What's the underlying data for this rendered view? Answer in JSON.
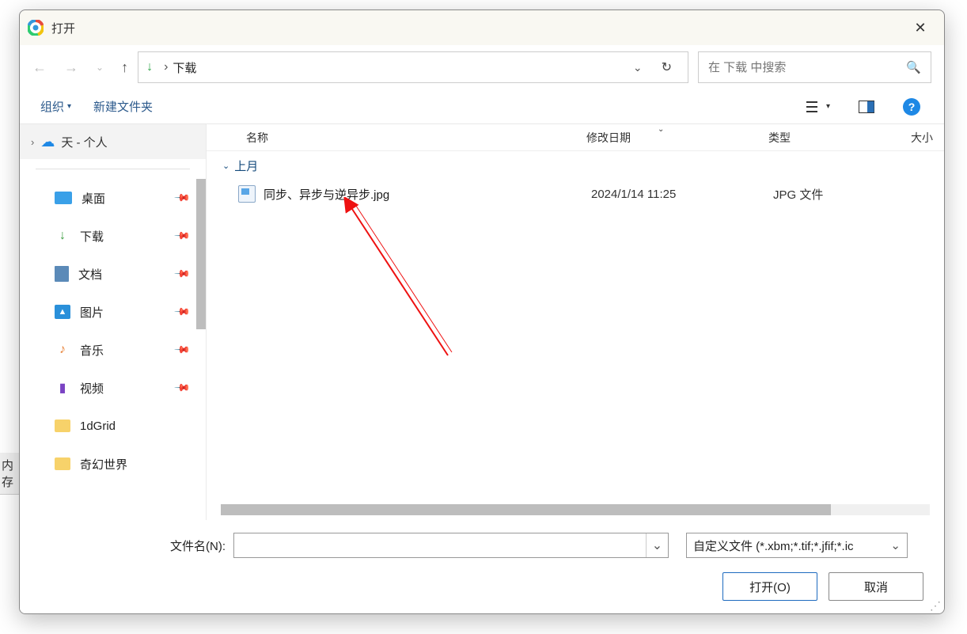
{
  "bg_label": "内存",
  "title": "打开",
  "address": {
    "location": "下载"
  },
  "search": {
    "placeholder": "在 下载 中搜索"
  },
  "toolbar": {
    "organize": "组织",
    "new_folder": "新建文件夹"
  },
  "sidebar": {
    "top": "天 - 个人",
    "items": [
      {
        "label": "桌面",
        "iconClass": "ico-desktop",
        "pinned": true
      },
      {
        "label": "下载",
        "iconClass": "ico-download",
        "glyph": "↓",
        "pinned": true
      },
      {
        "label": "文档",
        "iconClass": "ico-doc",
        "pinned": true
      },
      {
        "label": "图片",
        "iconClass": "ico-pic",
        "glyph": "▲",
        "pinned": true
      },
      {
        "label": "音乐",
        "iconClass": "ico-music",
        "glyph": "♪",
        "pinned": true
      },
      {
        "label": "视频",
        "iconClass": "ico-video",
        "glyph": "▮",
        "pinned": true
      },
      {
        "label": "1dGrid",
        "iconClass": "ico-folder",
        "pinned": false
      },
      {
        "label": "奇幻世界",
        "iconClass": "ico-folder",
        "pinned": false
      }
    ]
  },
  "columns": {
    "name": "名称",
    "date": "修改日期",
    "type": "类型",
    "size": "大小"
  },
  "group": "上月",
  "files": [
    {
      "name": "同步、异步与逆异步.jpg",
      "date": "2024/1/14 11:25",
      "type": "JPG 文件"
    }
  ],
  "footer": {
    "filename_label": "文件名(N):",
    "filter": "自定义文件 (*.xbm;*.tif;*.jfif;*.ic",
    "open": "打开(O)",
    "cancel": "取消"
  }
}
